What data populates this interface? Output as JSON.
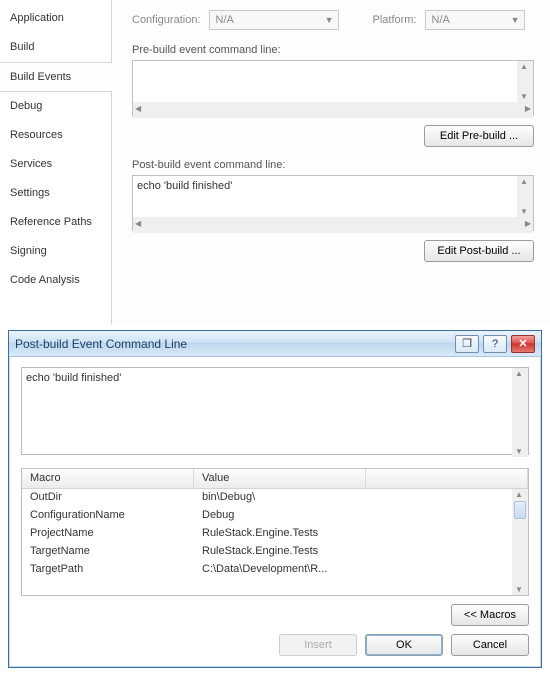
{
  "sidebar": {
    "items": [
      {
        "label": "Application"
      },
      {
        "label": "Build"
      },
      {
        "label": "Build Events"
      },
      {
        "label": "Debug"
      },
      {
        "label": "Resources"
      },
      {
        "label": "Services"
      },
      {
        "label": "Settings"
      },
      {
        "label": "Reference Paths"
      },
      {
        "label": "Signing"
      },
      {
        "label": "Code Analysis"
      }
    ],
    "selected_index": 2
  },
  "config": {
    "configuration_label": "Configuration:",
    "configuration_value": "N/A",
    "platform_label": "Platform:",
    "platform_value": "N/A"
  },
  "prebuild": {
    "label": "Pre-build event command line:",
    "value": "",
    "edit_button": "Edit Pre-build ..."
  },
  "postbuild": {
    "label": "Post-build event command line:",
    "value": "echo 'build finished'",
    "edit_button": "Edit Post-build ..."
  },
  "dialog": {
    "title": "Post-build Event Command Line",
    "textarea_value": "echo 'build finished'",
    "table": {
      "headers": [
        "Macro",
        "Value"
      ],
      "rows": [
        {
          "macro": "OutDir",
          "value": "bin\\Debug\\"
        },
        {
          "macro": "ConfigurationName",
          "value": "Debug"
        },
        {
          "macro": "ProjectName",
          "value": "RuleStack.Engine.Tests"
        },
        {
          "macro": "TargetName",
          "value": "RuleStack.Engine.Tests"
        },
        {
          "macro": "TargetPath",
          "value": "C:\\Data\\Development\\R..."
        }
      ]
    },
    "buttons": {
      "macros": "<< Macros",
      "insert": "Insert",
      "ok": "OK",
      "cancel": "Cancel"
    }
  }
}
